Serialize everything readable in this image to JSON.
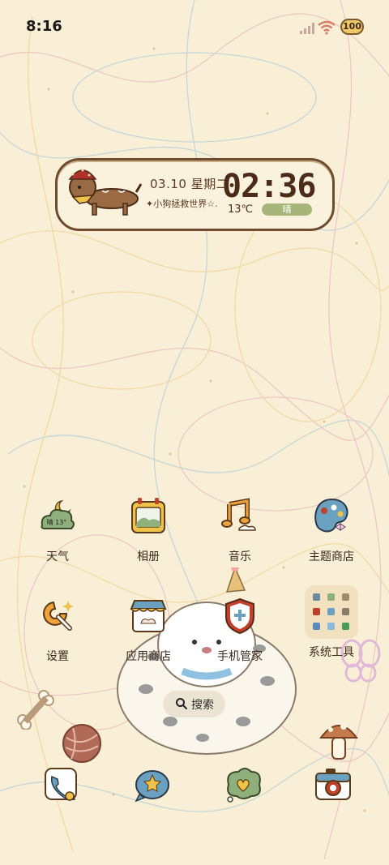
{
  "status_bar": {
    "time": "8:16",
    "battery": "100"
  },
  "widget": {
    "date": "03.10 星期二",
    "slogan": "✦小狗拯救世界☆.",
    "clock": "02:36",
    "temperature": "13℃",
    "weather": "晴"
  },
  "apps": [
    {
      "label": "天气",
      "icon": "weather-icon",
      "icon_text": "晴 13°"
    },
    {
      "label": "相册",
      "icon": "gallery-icon"
    },
    {
      "label": "音乐",
      "icon": "music-icon"
    },
    {
      "label": "主题商店",
      "icon": "theme-store-icon"
    },
    {
      "label": "设置",
      "icon": "settings-icon"
    },
    {
      "label": "应用商店",
      "icon": "app-store-icon"
    },
    {
      "label": "手机管家",
      "icon": "phone-manager-icon"
    },
    {
      "label": "系统工具",
      "icon": "system-tools-folder-icon"
    }
  ],
  "search": {
    "label": "搜索"
  },
  "dock": [
    {
      "icon": "phone-icon"
    },
    {
      "icon": "messages-icon"
    },
    {
      "icon": "chat-icon"
    },
    {
      "icon": "camera-icon"
    }
  ],
  "colors": {
    "background": "#f8efd6",
    "brown": "#6e4a2e",
    "weather_pill": "#a8b57a"
  }
}
